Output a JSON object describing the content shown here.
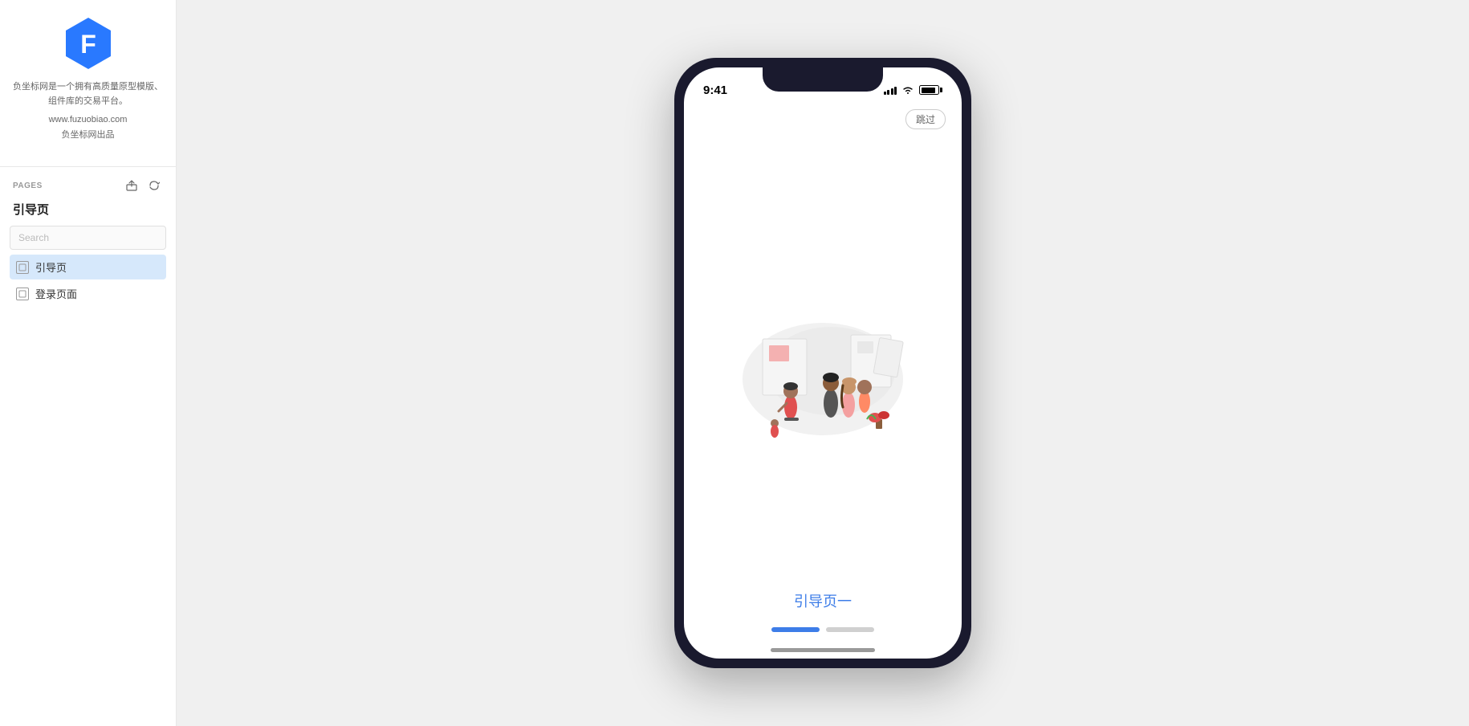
{
  "sidebar": {
    "logo_description": "负坐标网是一个拥有高质量原型模版、组件库的交易平台。",
    "logo_url": "www.fuzuobiao.com",
    "logo_brand": "负坐标网出品",
    "pages_label": "PAGES",
    "pages_title": "引导页",
    "search_placeholder": "Search",
    "export_icon": "export-icon",
    "add_icon": "add-icon",
    "page_items": [
      {
        "label": "引导页",
        "active": true
      },
      {
        "label": "登录页面",
        "active": false
      }
    ]
  },
  "phone": {
    "status_time": "9:41",
    "skip_label": "跳过",
    "main_title": "引导页一",
    "progress": [
      {
        "active": true
      },
      {
        "active": false
      }
    ]
  }
}
